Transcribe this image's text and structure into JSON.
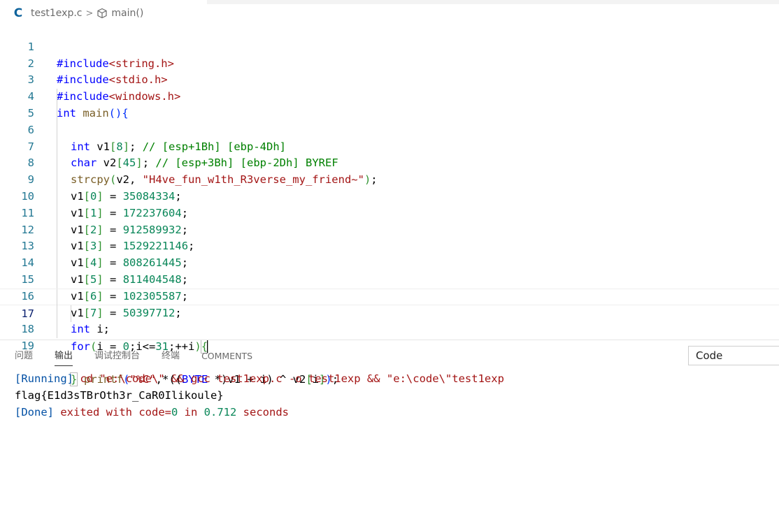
{
  "breadcrumb": {
    "lang_icon": "C",
    "file": "test1exp.c",
    "separator": ">",
    "symbol_icon": "cube-icon",
    "symbol": "main()"
  },
  "editor": {
    "line_numbers": [
      "1",
      "2",
      "3",
      "4",
      "5",
      "6",
      "7",
      "8",
      "9",
      "10",
      "11",
      "12",
      "13",
      "14",
      "15",
      "16",
      "17",
      "18",
      "19"
    ],
    "active_line": "17",
    "code": {
      "l1": {
        "pp": "#include",
        "inc": "<string.h>"
      },
      "l2": {
        "pp": "#include",
        "inc": "<stdio.h>"
      },
      "l3": {
        "pp": "#include",
        "inc": "<windows.h>"
      },
      "l4": {
        "kw": "int",
        "name": " main",
        "paren": "(){"
      },
      "l5": {
        "kw": "int",
        "rest": " v1",
        "lb": "[",
        "num": "8",
        "rb": "]",
        "semi": "; ",
        "cm": "// [esp+1Bh] [ebp-4Dh]"
      },
      "l6": {
        "kw": "char",
        "rest": " v2",
        "lb": "[",
        "num": "45",
        "rb": "]",
        "semi": "; ",
        "cm": "// [esp+3Bh] [ebp-2Dh] BYREF"
      },
      "l7": {
        "fn": "strcpy",
        "lp": "(",
        "a": "v2, ",
        "str": "\"H4ve_fun_w1th_R3verse_my_friend~\"",
        "rp": ")",
        "semi": ";"
      },
      "l8": {
        "v": "v1",
        "lb": "[",
        "i": "0",
        "rb": "]",
        "eq": " = ",
        "num": "35084334",
        "semi": ";"
      },
      "l9": {
        "v": "v1",
        "lb": "[",
        "i": "1",
        "rb": "]",
        "eq": " = ",
        "num": "172237604",
        "semi": ";"
      },
      "l10": {
        "v": "v1",
        "lb": "[",
        "i": "2",
        "rb": "]",
        "eq": " = ",
        "num": "912589932",
        "semi": ";"
      },
      "l11": {
        "v": "v1",
        "lb": "[",
        "i": "3",
        "rb": "]",
        "eq": " = ",
        "num": "1529221146",
        "semi": ";"
      },
      "l12": {
        "v": "v1",
        "lb": "[",
        "i": "4",
        "rb": "]",
        "eq": " = ",
        "num": "808261445",
        "semi": ";"
      },
      "l13": {
        "v": "v1",
        "lb": "[",
        "i": "5",
        "rb": "]",
        "eq": " = ",
        "num": "811404548",
        "semi": ";"
      },
      "l14": {
        "v": "v1",
        "lb": "[",
        "i": "6",
        "rb": "]",
        "eq": " = ",
        "num": "102305587",
        "semi": ";"
      },
      "l15": {
        "v": "v1",
        "lb": "[",
        "i": "7",
        "rb": "]",
        "eq": " = ",
        "num": "50397712",
        "semi": ";"
      },
      "l16": {
        "kw": "int",
        "rest": " i;"
      },
      "l17": {
        "kw": "for",
        "lp": "(",
        "a": "i = ",
        "n0": "0",
        "b": ";i<=",
        "n31": "31",
        "c": ";++i",
        "rp": ")",
        "lb": "{"
      },
      "l18": {
        "fn": "printf",
        "lp": "(",
        "str": "\"%C\"",
        "a": ",*((",
        "kw": "BYTE",
        "b": " *)v1 + i) ^ v2",
        "lb": "[",
        "i": "i",
        "rb": "]",
        "rp": ")",
        "semi": ";"
      },
      "l19": {
        "rb": "}"
      }
    }
  },
  "panel": {
    "tabs": [
      "问题",
      "输出",
      "调试控制台",
      "终端",
      "COMMENTS"
    ],
    "active_tab": "输出",
    "channel_select": "Code"
  },
  "output": {
    "line1": {
      "tag": "[Running]",
      "cmd": " cd \"e:\\code\\\" && gcc test1exp.c -o test1exp && \"e:\\code\\\"test1exp"
    },
    "line2": "flag{E1d3sTBrOth3r_CaR0Ilikoule}",
    "line3": {
      "tag": "[Done]",
      "a": " exited with ",
      "b": "code=",
      "c": "0",
      "d": " in ",
      "e": "0.712",
      "f": " seconds"
    }
  },
  "colors": {
    "keyword": "#0000ff",
    "string": "#a31515",
    "number": "#098658",
    "comment": "#008000",
    "function": "#795e26",
    "line_number": "#237893",
    "accent": "#0e639c"
  }
}
